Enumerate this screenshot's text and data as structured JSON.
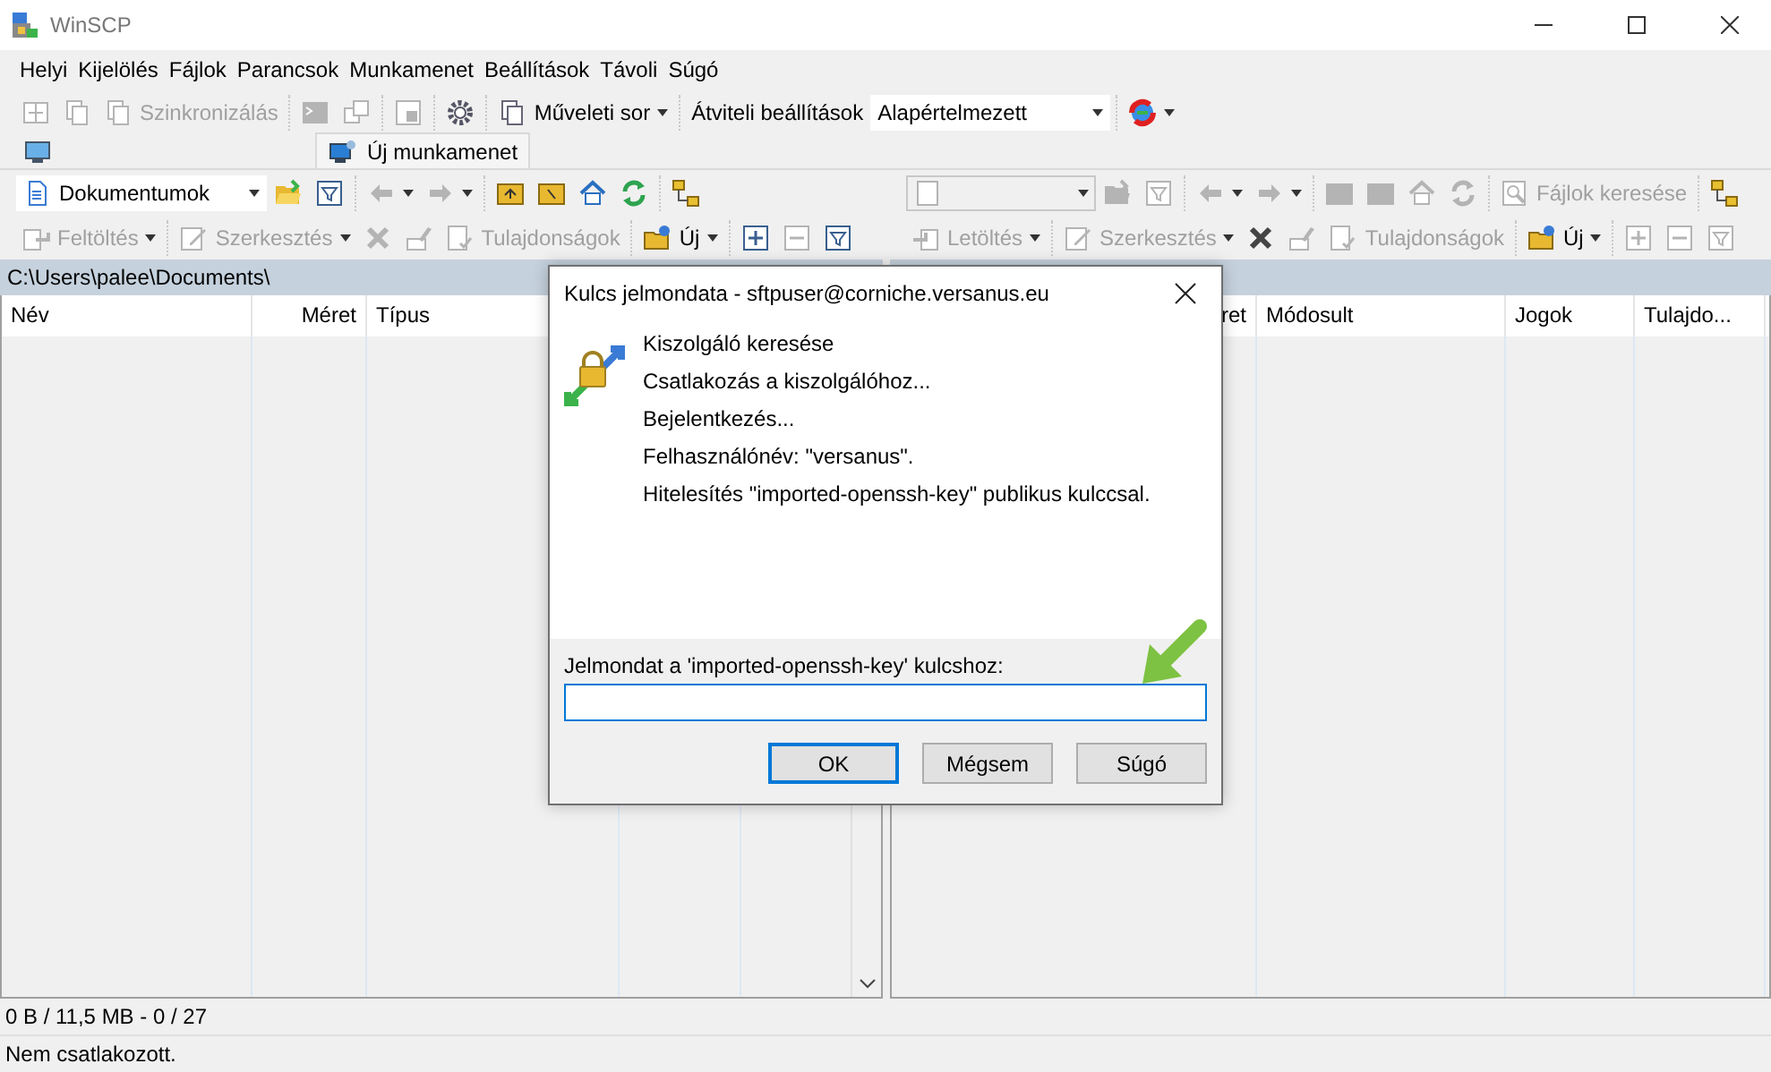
{
  "window": {
    "title": "WinSCP"
  },
  "menu": [
    "Helyi",
    "Kijelölés",
    "Fájlok",
    "Parancsok",
    "Munkamenet",
    "Beállítások",
    "Távoli",
    "Súgó"
  ],
  "main_toolbar": [
    [
      {
        "kind": "button",
        "disabled": true
      },
      {
        "kind": "button",
        "disabled": true
      },
      {
        "kind": "button",
        "label": "Szinkronizálás",
        "disabled": true
      }
    ],
    [
      {
        "kind": "button",
        "disabled": true
      },
      {
        "kind": "button",
        "disabled": true
      }
    ],
    [
      {
        "kind": "button",
        "disabled": true
      }
    ],
    [
      {
        "kind": "button",
        "disabled": false
      }
    ],
    [
      {
        "kind": "button",
        "label": "Műveleti sor",
        "dropdown": true,
        "disabled": false
      }
    ],
    [
      {
        "kind": "label",
        "label": "Átviteli beállítások"
      },
      {
        "kind": "combo",
        "value": "Alapértelmezett",
        "disabled": false
      }
    ],
    [
      {
        "kind": "button",
        "dropdown": true,
        "disabled": false
      }
    ]
  ],
  "session_tabs": [
    {
      "kind": "icon",
      "selected": false
    },
    {
      "kind": "tab",
      "label": "Új munkamenet",
      "selected": true
    }
  ],
  "left_panel": {
    "nav_toolbar": [
      [
        {
          "kind": "combo",
          "value": "Dokumentumok",
          "disabled": false
        },
        {
          "kind": "button",
          "disabled": false
        },
        {
          "kind": "button",
          "disabled": false
        }
      ],
      [
        {
          "kind": "button",
          "dropdown": true,
          "disabled": true
        },
        {
          "kind": "button",
          "dropdown": true,
          "disabled": true
        }
      ],
      [
        {
          "kind": "button",
          "disabled": false
        },
        {
          "kind": "button",
          "disabled": false
        },
        {
          "kind": "button",
          "disabled": false
        },
        {
          "kind": "button",
          "disabled": false
        }
      ],
      [
        {
          "kind": "button",
          "disabled": false
        }
      ]
    ],
    "file_toolbar": [
      [
        {
          "kind": "button",
          "label": "Feltöltés",
          "dropdown": true,
          "disabled": true
        }
      ],
      [
        {
          "kind": "button",
          "label": "Szerkesztés",
          "dropdown": true,
          "disabled": true
        },
        {
          "kind": "button",
          "disabled": true
        },
        {
          "kind": "button",
          "disabled": true
        },
        {
          "kind": "button",
          "label": "Tulajdonságok",
          "disabled": true
        }
      ],
      [
        {
          "kind": "button",
          "label": "Új",
          "dropdown": true,
          "disabled": false
        }
      ],
      [
        {
          "kind": "button",
          "disabled": false
        },
        {
          "kind": "button",
          "disabled": true
        },
        {
          "kind": "button",
          "disabled": false
        }
      ]
    ],
    "path": "C:\\Users\\palee\\Documents\\",
    "columns": [
      "Név",
      "Méret",
      "Típus"
    ]
  },
  "right_panel": {
    "nav_toolbar": [
      [
        {
          "kind": "combo",
          "disabled": true
        },
        {
          "kind": "button",
          "disabled": true
        },
        {
          "kind": "button",
          "disabled": true
        }
      ],
      [
        {
          "kind": "button",
          "dropdown": true,
          "disabled": true
        },
        {
          "kind": "button",
          "dropdown": true,
          "disabled": true
        }
      ],
      [
        {
          "kind": "button",
          "disabled": true
        },
        {
          "kind": "button",
          "disabled": true
        },
        {
          "kind": "button",
          "disabled": true
        },
        {
          "kind": "button",
          "disabled": true
        }
      ],
      [
        {
          "kind": "button",
          "label": "Fájlok keresése",
          "disabled": true
        }
      ],
      [
        {
          "kind": "button",
          "disabled": false
        }
      ]
    ],
    "file_toolbar": [
      [
        {
          "kind": "button",
          "label": "Letöltés",
          "dropdown": true,
          "disabled": true
        }
      ],
      [
        {
          "kind": "button",
          "label": "Szerkesztés",
          "dropdown": true,
          "disabled": true
        },
        {
          "kind": "button",
          "disabled": false
        },
        {
          "kind": "button",
          "disabled": true
        },
        {
          "kind": "button",
          "label": "Tulajdonságok",
          "disabled": true
        }
      ],
      [
        {
          "kind": "button",
          "label": "Új",
          "dropdown": true,
          "disabled": false
        }
      ],
      [
        {
          "kind": "button",
          "disabled": true
        },
        {
          "kind": "button",
          "disabled": true
        },
        {
          "kind": "button",
          "disabled": true
        }
      ]
    ],
    "columns": [
      "ret",
      "Módosult",
      "Jogok",
      "Tulajdo..."
    ]
  },
  "status_bar": {
    "transfer": "0 B / 11,5 MB - 0 / 27",
    "connection": "Nem csatlakozott."
  },
  "dialog": {
    "title": "Kulcs jelmondata - sftpuser@corniche.versanus.eu",
    "messages": [
      "Kiszolgáló keresése",
      "Csatlakozás a kiszolgálóhoz...",
      "Bejelentkezés...",
      "Felhasználónév: \"versanus\".",
      "Hitelesítés \"imported-openssh-key\" publikus kulccsal."
    ],
    "prompt": "Jelmondat a 'imported-openssh-key' kulcshoz:",
    "field": {
      "focused": true
    },
    "buttons": [
      {
        "label": "OK",
        "default": true
      },
      {
        "label": "Mégsem",
        "default": false
      },
      {
        "label": "Súgó",
        "default": false
      }
    ]
  }
}
